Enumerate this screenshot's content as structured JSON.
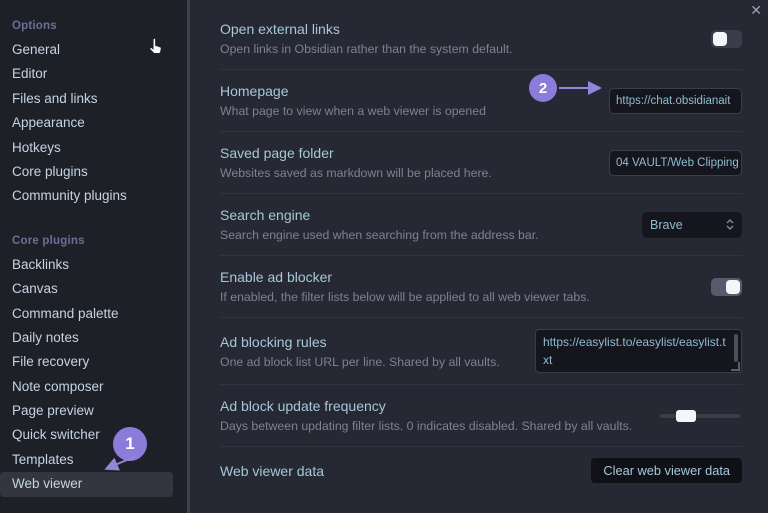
{
  "window": {
    "close_icon": "✕"
  },
  "colors": {
    "sidebar_bg": "#1e2028",
    "main_bg": "#262833",
    "heading_text": "#a6c8d9",
    "description_text": "#7c8392",
    "section_header": "#6a6f96",
    "input_bg": "#15161d",
    "annotation_purple": "#8a7cd8",
    "toggle_knob": "#f5f6f8"
  },
  "sidebar": {
    "sections": [
      {
        "header": "Options",
        "items": [
          "General",
          "Editor",
          "Files and links",
          "Appearance",
          "Hotkeys",
          "Core plugins",
          "Community plugins"
        ],
        "selected": ""
      },
      {
        "header": "Core plugins",
        "items": [
          "Backlinks",
          "Canvas",
          "Command palette",
          "Daily notes",
          "File recovery",
          "Note composer",
          "Page preview",
          "Quick switcher",
          "Templates",
          "Web viewer"
        ],
        "selected": "Web viewer"
      }
    ]
  },
  "settings": [
    {
      "name": "Open external links",
      "desc": "Open links in Obsidian rather than the system default.",
      "control": {
        "type": "toggle",
        "state": "off"
      }
    },
    {
      "name": "Homepage",
      "desc": "What page to view when a web viewer is opened",
      "control": {
        "type": "text",
        "value": "https://chat.obsidianait"
      }
    },
    {
      "name": "Saved page folder",
      "desc": "Websites saved as markdown will be placed here.",
      "control": {
        "type": "text",
        "value": "04 VAULT/Web Clipping"
      }
    },
    {
      "name": "Search engine",
      "desc": "Search engine used when searching from the address bar.",
      "control": {
        "type": "select",
        "value": "Brave"
      }
    },
    {
      "name": "Enable ad blocker",
      "desc": "If enabled, the filter lists below will be applied to all web viewer tabs.",
      "control": {
        "type": "toggle",
        "state": "on"
      }
    },
    {
      "name": "Ad blocking rules",
      "desc": "One ad block list URL per line. Shared by all vaults.",
      "control": {
        "type": "textarea",
        "value": "https://easylist.to/easylist/easylist.txt"
      }
    },
    {
      "name": "Ad block update frequency",
      "desc": "Days between updating filter lists. 0 indicates disabled. Shared by all vaults.",
      "control": {
        "type": "slider",
        "position": 0.25
      }
    },
    {
      "name": "Web viewer data",
      "desc": "",
      "control": {
        "type": "button",
        "label": "Clear web viewer data"
      }
    }
  ],
  "annotations": [
    {
      "number": "1",
      "target": "Web viewer sidebar item"
    },
    {
      "number": "2",
      "target": "Homepage input"
    }
  ]
}
